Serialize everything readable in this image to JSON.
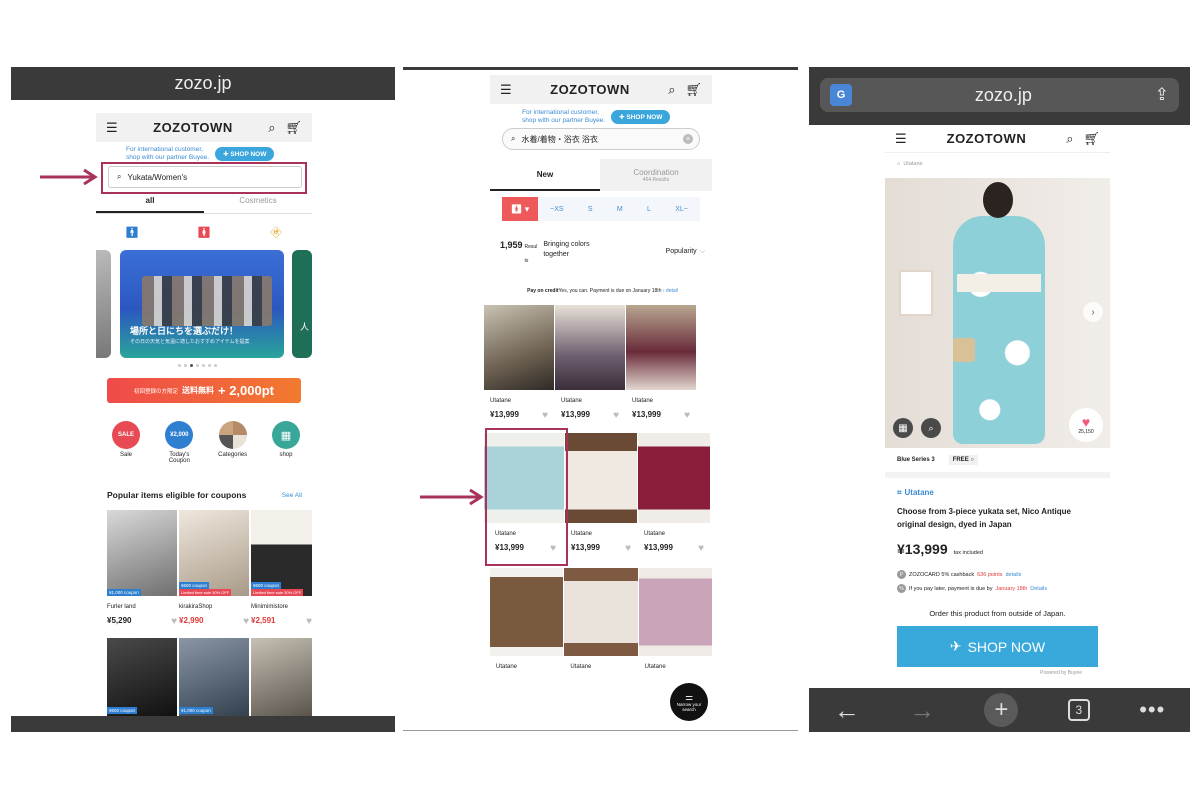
{
  "left": {
    "url": "zozo.jp",
    "logo": "ZOZOTOWN",
    "intl_text_1": "For international customer,",
    "intl_text_2": "shop with our partner Buyee.",
    "shop_now": "✚ SHOP NOW",
    "search_value": "Yukata/Women's",
    "tabs": [
      "all",
      "Cosmetics"
    ],
    "banner_text_1": "場所と日にちを選ぶだけ！",
    "banner_text_2": "その日の天気と気温に適したおすすめアイテムを提案",
    "banner_side": "人",
    "promo_prefix": "初回登録の方限定",
    "promo_mid": "送料無料",
    "promo_points": "+ 2,000pt",
    "categories": [
      {
        "label": "Sale",
        "icon": "SALE",
        "color": "#e84a55"
      },
      {
        "label": "Today's Coupon",
        "icon": "¥2,000",
        "color": "#2f7fd0"
      },
      {
        "label": "Categories",
        "icon": "",
        "color": "#b58a66"
      },
      {
        "label": "shop",
        "icon": "▦",
        "color": "#38a79a"
      }
    ],
    "coupon_section_title": "Popular items eligible for coupons",
    "see_all": "See All",
    "products": [
      {
        "brand": "Furler land",
        "price": "¥5,290",
        "coupon": "¥1,000 coupon",
        "sale": ""
      },
      {
        "brand": "kirakiraShop",
        "price": "¥2,990",
        "coupon": "¥600 coupon",
        "sale": "Limited time sale 30% OFF"
      },
      {
        "brand": "Minimimistore",
        "price": "¥2,591",
        "coupon": "¥600 coupon",
        "sale": "Limited time sale 30% OFF"
      }
    ],
    "bottom_coupons": [
      "¥600 coupon",
      "¥1,000 coupon"
    ]
  },
  "middle": {
    "logo": "ZOZOTOWN",
    "intl_text_1": "For international customer,",
    "intl_text_2": "shop with our partner Buyee.",
    "shop_now": "✚ SHOP NOW",
    "search_value": "水着/着物・浴衣 浴衣",
    "tab_new": "New",
    "tab_coordination": "Coordination",
    "coordination_count": "464 Results",
    "sizes": [
      "~XS",
      "S",
      "M",
      "L",
      "XL~"
    ],
    "results_count": "1,959",
    "results_label": "Resul",
    "results_label_2": "ts",
    "bringing": "Bringing colors together",
    "sort": "Popularity",
    "pay_bold": "Pay on credit",
    "pay_text": "Yes, you can. Payment is due on January 18th",
    "pay_link": "› detail",
    "grid": [
      {
        "brand": "Utatane",
        "price": "¥13,999"
      },
      {
        "brand": "Utatane",
        "price": "¥13,999"
      },
      {
        "brand": "Utatane",
        "price": "¥13,999"
      },
      {
        "brand": "Utatane",
        "price": "¥13,999"
      },
      {
        "brand": "Utatane",
        "price": "¥13,999"
      },
      {
        "brand": "Utatane",
        "price": "¥13,999"
      },
      {
        "brand": "Utatane",
        "price": ""
      },
      {
        "brand": "Utatane",
        "price": ""
      },
      {
        "brand": "Utatane",
        "price": ""
      }
    ],
    "narrow_search": "Narrow your search"
  },
  "right": {
    "url": "zozo.jp",
    "logo": "ZOZOTOWN",
    "shop_tag": "Utatane",
    "like_count": "25,150",
    "series": "Blue Series 3",
    "size": "FREE ○",
    "brand": "Utatane",
    "title": "Choose from 3-piece yukata set, Nico Antique original design, dyed in Japan",
    "price": "¥13,999",
    "tax": "tax included",
    "zozocard_text": "ZOZOCARD 5% cashback",
    "zozocard_points": "636 points",
    "zozocard_link": "details",
    "pay_later_text": "If you pay later, payment is due by",
    "pay_later_date": "January 18th",
    "pay_later_link": "Details",
    "order_outside": "Order this product from outside of Japan.",
    "shop_now": "SHOP NOW",
    "powered": "Powered by Buyee",
    "tab_count": "3"
  }
}
